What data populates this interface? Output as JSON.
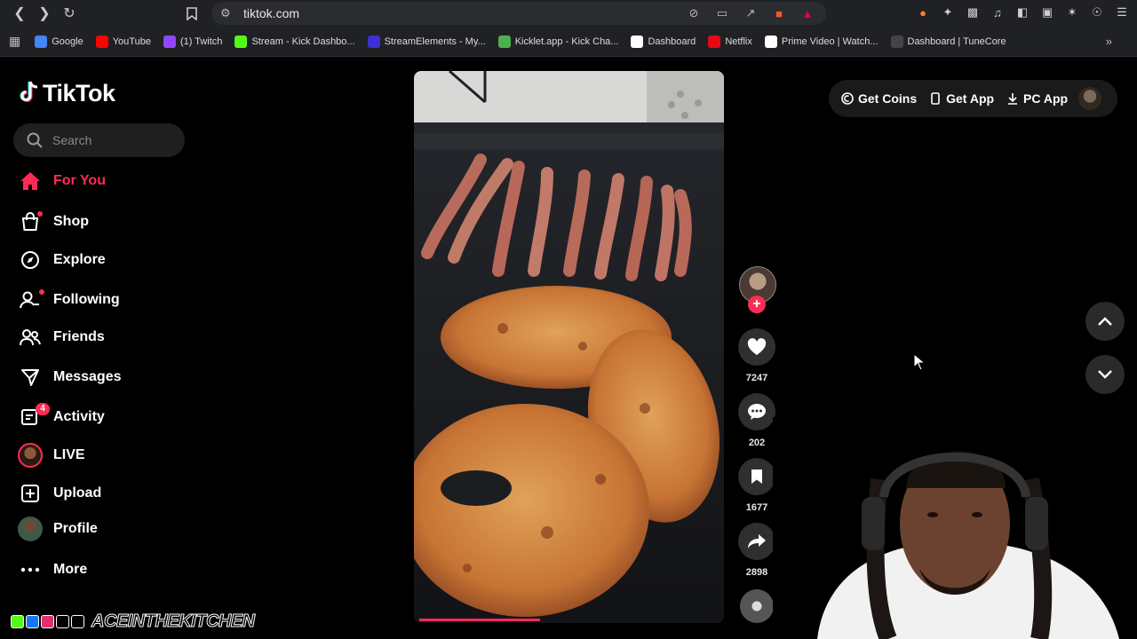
{
  "browser": {
    "url": "tiktok.com",
    "bookmarks": [
      {
        "label": "Google",
        "color": "#4285f4"
      },
      {
        "label": "YouTube",
        "color": "#ff0000"
      },
      {
        "label": "(1) Twitch",
        "color": "#9146ff"
      },
      {
        "label": "Stream - Kick Dashbo...",
        "color": "#53fc18"
      },
      {
        "label": "StreamElements - My...",
        "color": "#3b2fd6"
      },
      {
        "label": "Kicklet.app - Kick Cha...",
        "color": "#4caf50"
      },
      {
        "label": "Dashboard",
        "color": "#ffffff"
      },
      {
        "label": "Netflix",
        "color": "#e50914"
      },
      {
        "label": "Prime Video | Watch...",
        "color": "#ffffff"
      },
      {
        "label": "Dashboard | TuneCore",
        "color": "#444444"
      }
    ]
  },
  "tiktok": {
    "logo": "TikTok",
    "search_placeholder": "Search",
    "nav": [
      {
        "label": "For You",
        "icon": "home-icon",
        "active": true
      },
      {
        "label": "Shop",
        "icon": "shop-icon"
      },
      {
        "label": "Explore",
        "icon": "compass-icon"
      },
      {
        "label": "Following",
        "icon": "following-icon"
      },
      {
        "label": "Friends",
        "icon": "friends-icon"
      },
      {
        "label": "Messages",
        "icon": "messages-icon"
      },
      {
        "label": "Activity",
        "icon": "activity-icon",
        "badge": "4"
      },
      {
        "label": "LIVE",
        "icon": "live-avatar"
      },
      {
        "label": "Upload",
        "icon": "upload-icon"
      },
      {
        "label": "Profile",
        "icon": "profile-avatar"
      },
      {
        "label": "More",
        "icon": "more-icon"
      }
    ],
    "topright": {
      "coins": "Get Coins",
      "app": "Get App",
      "pc": "PC App"
    },
    "video": {
      "likes": "7247",
      "comments": "202",
      "saves": "1677",
      "shares": "2898",
      "progress": 0.39
    }
  },
  "overlay": {
    "channel_name": "ACEINTHEKITCHEN"
  },
  "colors": {
    "accent": "#fe2c55",
    "background": "#000000"
  }
}
